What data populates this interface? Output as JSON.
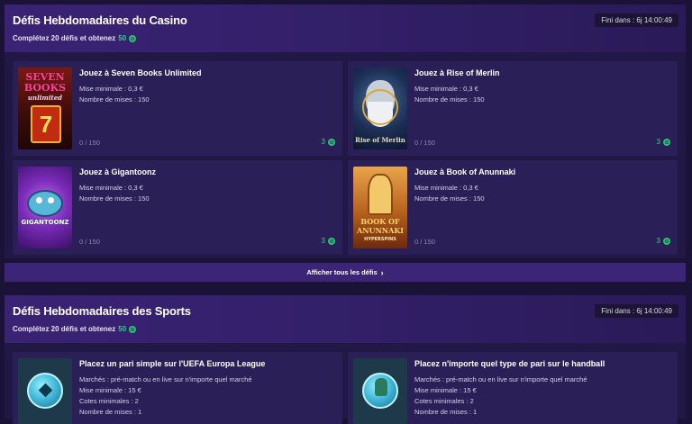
{
  "casino": {
    "title": "Défis Hebdomadaires du Casino",
    "subtitle": "Complétez 20 défis et obtenez",
    "reward_amount": "50",
    "timer": "Fini dans : 6j 14:00:49",
    "cards": [
      {
        "title": "Jouez à Seven Books Unlimited",
        "line1": "Mise minimale : 0,3 €",
        "line2": "Nombre de mises : 150",
        "progress": "0 / 150",
        "reward": "3",
        "thumb_text_1": "SEVEN",
        "thumb_text_2": "BOOKS",
        "thumb_text_3": "unlimited"
      },
      {
        "title": "Jouez à Rise of Merlin",
        "line1": "Mise minimale : 0,3 €",
        "line2": "Nombre de mises : 150",
        "progress": "0 / 150",
        "reward": "3",
        "thumb_text_1": "Rise of Merlin"
      },
      {
        "title": "Jouez à Gigantoonz",
        "line1": "Mise minimale : 0,3 €",
        "line2": "Nombre de mises : 150",
        "progress": "0 / 150",
        "reward": "3",
        "thumb_text_1": "GIGANTOONZ"
      },
      {
        "title": "Jouez à Book of Anunnaki",
        "line1": "Mise minimale : 0,3 €",
        "line2": "Nombre de mises : 150",
        "progress": "0 / 150",
        "reward": "3",
        "thumb_text_1": "BOOK OF",
        "thumb_text_2": "ANUNNAKI",
        "thumb_text_3": "HYPERSPINS"
      }
    ],
    "show_all": "Afficher tous les défis"
  },
  "sports": {
    "title": "Défis Hebdomadaires des Sports",
    "subtitle": "Complétez 20 défis et obtenez",
    "reward_amount": "50",
    "timer": "Fini dans : 6j 14:00:49",
    "cards": [
      {
        "title": "Placez un pari simple sur l'UEFA Europa League",
        "line1": "Marchés : pré-match ou en live sur n'importe quel marché",
        "line2": "Mise minimale : 15 €",
        "line3": "Cotes minimales : 2",
        "line4": "Nombre de mises : 1"
      },
      {
        "title": "Placez n'importe quel type de pari sur le handball",
        "line1": "Marchés : pré-match ou en live sur n'importe quel marché",
        "line2": "Mise minimale : 15 €",
        "line3": "Cotes minimales : 2",
        "line4": "Nombre de mises : 1"
      }
    ]
  },
  "colors": {
    "accent_green": "#35d08a",
    "header_purple": "#3a2274",
    "card_bg": "#2b1f57"
  }
}
